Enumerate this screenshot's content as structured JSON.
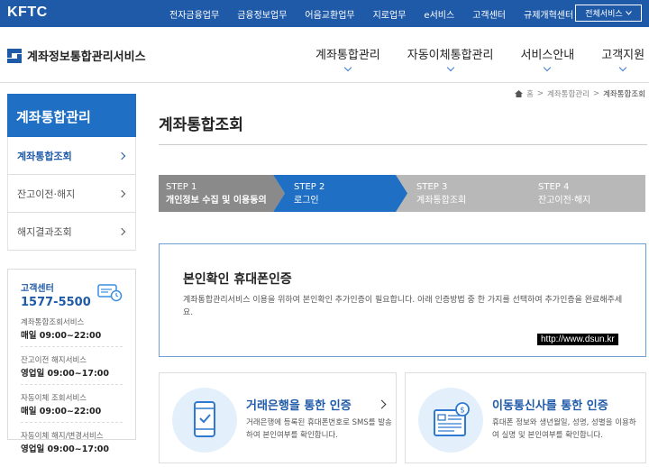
{
  "top_bar": {
    "logo": "KFTC",
    "links": [
      "전자금융업무",
      "금융정보업무",
      "어음교환업무",
      "지로업무",
      "e서비스",
      "고객센터",
      "규제개혁센터"
    ],
    "all_services": "전체서비스"
  },
  "header": {
    "brand": "계좌정보통합관리서비스",
    "menu": [
      "계좌통합관리",
      "자동이체통합관리",
      "서비스안내",
      "고객지원"
    ]
  },
  "sidebar": {
    "title": "계좌통합관리",
    "items": [
      {
        "label": "계좌통합조회"
      },
      {
        "label": "잔고이전·해지"
      },
      {
        "label": "해지결과조회"
      }
    ]
  },
  "customer_center": {
    "title": "고객센터",
    "phone": "1577-5500",
    "hours": [
      {
        "label": "계좌통합조회서비스",
        "value": "매일 09:00~22:00"
      },
      {
        "label": "잔고이전 해지서비스",
        "value": "영업일 09:00~17:00"
      },
      {
        "label": "자동이체 조회서비스",
        "value": "매일 09:00~22:00"
      },
      {
        "label": "자동이체 해지/변경서비스",
        "value": "영업일 09:00~17:00"
      }
    ]
  },
  "breadcrumb": [
    "홈",
    "계좌통합관리",
    "계좌통합조회"
  ],
  "page_title": "계좌통합조회",
  "steps": [
    {
      "num": "STEP 1",
      "desc": "개인정보 수집 및 이용동의",
      "state": "done"
    },
    {
      "num": "STEP 2",
      "desc": "로그인",
      "state": "active"
    },
    {
      "num": "STEP 3",
      "desc": "계좌통합조회",
      "state": "todo"
    },
    {
      "num": "STEP 4",
      "desc": "잔고이전·해지",
      "state": "todo"
    }
  ],
  "auth_box": {
    "title": "본인확인 휴대폰인증",
    "desc": "계좌통합관리서비스 이용을 위하여 본인확인 추가인증이 필요합니다. 아래 인증방법 중 한 가지를 선택하여 추가인증을 완료해주세요."
  },
  "watermark": "http://www.dsun.kr",
  "cards": [
    {
      "title": "거래은행을 통한 인증",
      "desc": "거래은행에 등록된 휴대폰번호로 SMS를 발송하여 본인여부를 확인합니다."
    },
    {
      "title": "이동통신사를 통한 인증",
      "desc": "휴대폰 정보와 생년월일, 성명, 성별을 이용하여 실명 및 본인여부를 확인합니다."
    }
  ],
  "colors": {
    "primary": "#1f5aa8",
    "sidebar_head": "#1f6fc5",
    "step_active": "#1f6fc5",
    "step_done": "#8a8a8a",
    "step_todo": "#b8b8b8",
    "card_circle": "#e3f0fb"
  }
}
